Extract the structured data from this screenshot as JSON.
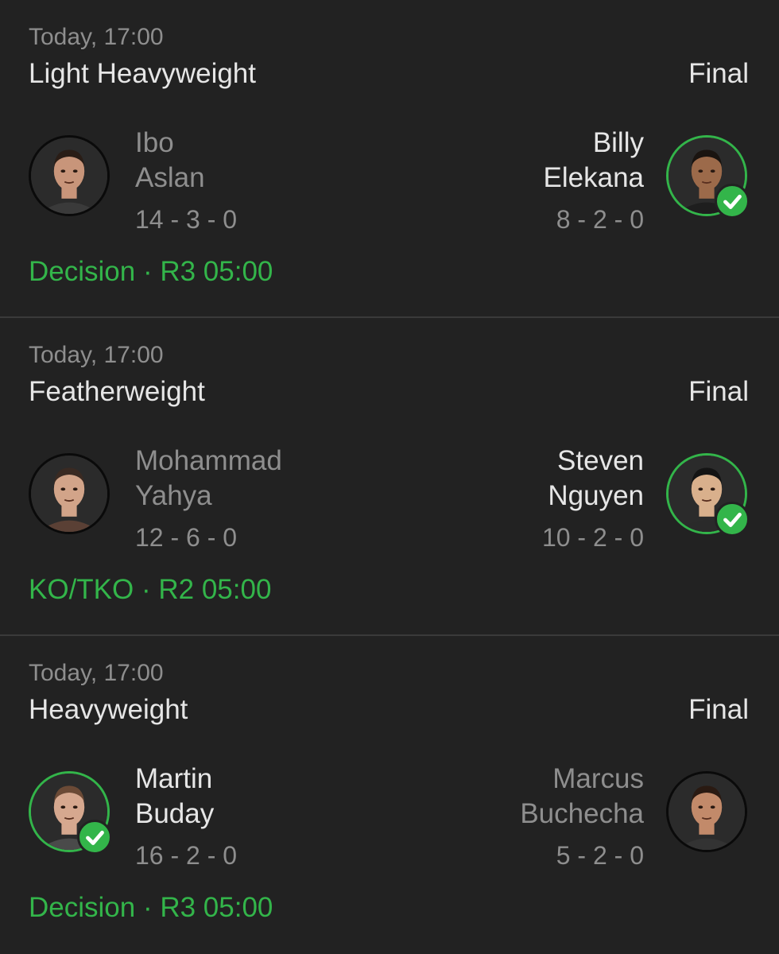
{
  "fights": [
    {
      "time": "Today, 17:00",
      "weight_class": "Light Heavyweight",
      "status": "Final",
      "left": {
        "first": "Ibo",
        "last": "Aslan",
        "record": "14 - 3 - 0",
        "winner": false
      },
      "right": {
        "first": "Billy",
        "last": "Elekana",
        "record": "8 - 2 - 0",
        "winner": true
      },
      "method": "Decision",
      "round_time": "R3 05:00"
    },
    {
      "time": "Today, 17:00",
      "weight_class": "Featherweight",
      "status": "Final",
      "left": {
        "first": "Mohammad",
        "last": "Yahya",
        "record": "12 - 6 - 0",
        "winner": false
      },
      "right": {
        "first": "Steven",
        "last": "Nguyen",
        "record": "10 - 2 - 0",
        "winner": true
      },
      "method": "KO/TKO",
      "round_time": "R2 05:00"
    },
    {
      "time": "Today, 17:00",
      "weight_class": "Heavyweight",
      "status": "Final",
      "left": {
        "first": "Martin",
        "last": "Buday",
        "record": "16 - 2 - 0",
        "winner": true
      },
      "right": {
        "first": "Marcus",
        "last": "Buchecha",
        "record": "5 - 2 - 0",
        "winner": false
      },
      "method": "Decision",
      "round_time": "R3 05:00"
    }
  ],
  "result_separator": " · ",
  "icons": {
    "winner": "checkmark-icon",
    "avatar": "fighter-headshot"
  },
  "colors": {
    "win_green": "#33b54a",
    "muted_text": "#8e8e8e",
    "primary_text": "#e6e6e6",
    "background": "#222222"
  }
}
